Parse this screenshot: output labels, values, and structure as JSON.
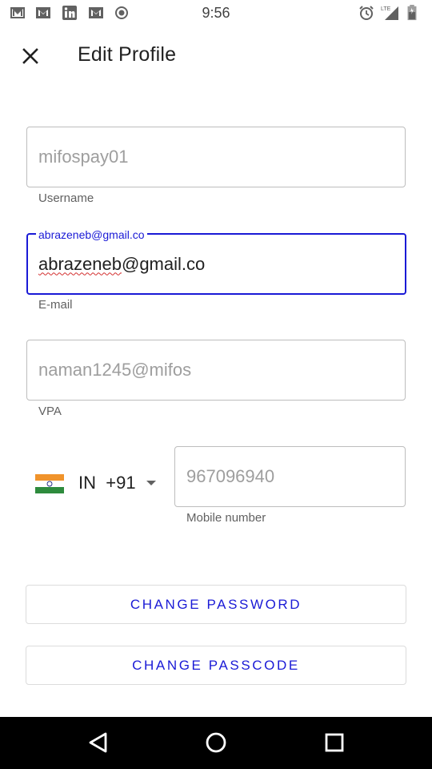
{
  "status_bar": {
    "time": "9:56",
    "left_icons": [
      "gmail-icon",
      "gmail-icon",
      "linkedin-icon",
      "gmail-icon",
      "radio-icon"
    ],
    "right_icons": [
      "alarm-icon",
      "lte-signal-icon",
      "battery-icon"
    ],
    "network": "LTE"
  },
  "header": {
    "title": "Edit Profile",
    "close_icon": "close-icon"
  },
  "form": {
    "username": {
      "value": "mifospay01",
      "helper": "Username"
    },
    "email": {
      "value": "abrazeneb@gmail.co",
      "label": "abrazeneb@gmail.co",
      "helper": "E-mail"
    },
    "vpa": {
      "value": "naman1245@mifos",
      "helper": "VPA"
    },
    "phone": {
      "country_code": "IN",
      "dial_code": "+91",
      "flag": "india-flag-icon",
      "value": "967096940",
      "helper": "Mobile number"
    }
  },
  "buttons": {
    "change_password": "CHANGE PASSWORD",
    "change_passcode": "CHANGE PASSCODE"
  },
  "colors": {
    "accent": "#1a1ad6",
    "error_underline": "#d32f2f",
    "border": "#bdbdbd"
  },
  "nav_bar": [
    "back-icon",
    "home-icon",
    "recents-icon"
  ]
}
